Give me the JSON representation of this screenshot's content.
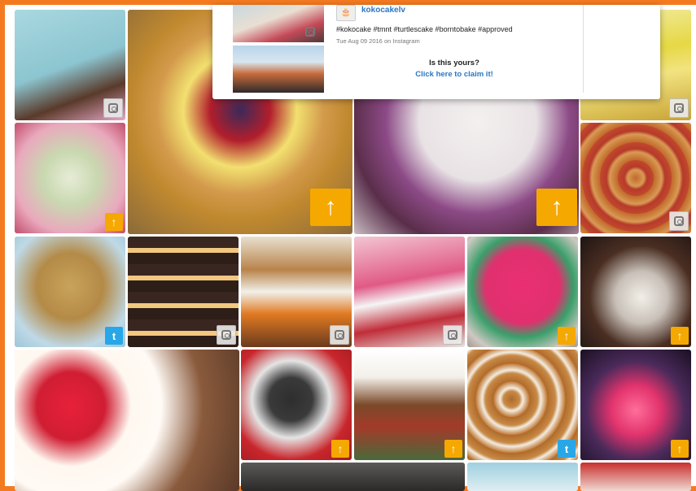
{
  "popup": {
    "username": "kokocakelv",
    "avatar_icon": "cake-avatar",
    "caption": "#kokocake #tmnt #turtlescake #borntobake #approved",
    "meta": "Tue Aug 09 2016 on Instagram",
    "question": "Is this yours?",
    "claim_link": "Click here to claim it!"
  },
  "badges": {
    "up": "↑",
    "twitter": "🐦"
  },
  "tiles": [
    {
      "name": "tile-cake-pops",
      "source": "instagram"
    },
    {
      "name": "tile-berry-layer-cake",
      "source": "upload"
    },
    {
      "name": "tile-purple-wedding-cake",
      "source": "upload"
    },
    {
      "name": "tile-lemon-bars",
      "source": "instagram"
    },
    {
      "name": "tile-meringue-kisses",
      "source": "upload"
    },
    {
      "name": "tile-cookies-baking-sheet",
      "source": "instagram"
    },
    {
      "name": "tile-jam-muffins",
      "source": "twitter"
    },
    {
      "name": "tile-whoopie-pies",
      "source": "instagram"
    },
    {
      "name": "tile-truffles-spread",
      "source": "instagram"
    },
    {
      "name": "tile-decorating-cake",
      "source": "instagram"
    },
    {
      "name": "tile-pink-floral-cake",
      "source": "upload"
    },
    {
      "name": "tile-dark-celebration-cake",
      "source": "upload"
    },
    {
      "name": "tile-raspberry-cream-dessert",
      "source": "none"
    },
    {
      "name": "tile-calculator-cake",
      "source": "upload"
    },
    {
      "name": "tile-tiered-novelty-cake",
      "source": "upload"
    },
    {
      "name": "tile-glazed-pastries",
      "source": "twitter"
    },
    {
      "name": "tile-birthday-candles-cake",
      "source": "upload"
    },
    {
      "name": "tile-dark-bottom",
      "source": "none"
    },
    {
      "name": "tile-blue-bottom",
      "source": "none"
    },
    {
      "name": "tile-red-bottom",
      "source": "none"
    }
  ],
  "colors": {
    "accent": "#f47a20",
    "link": "#2b77c4",
    "upload_badge": "#f5a800",
    "twitter": "#28a7e8"
  }
}
